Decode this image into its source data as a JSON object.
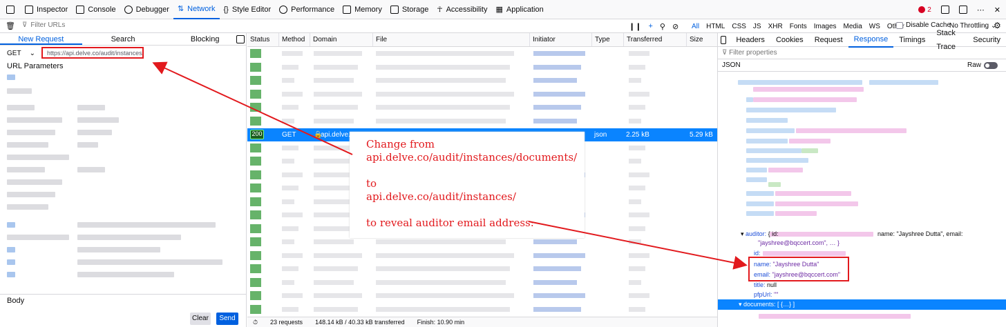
{
  "toolbar": {
    "tabs": [
      {
        "label": "Inspector"
      },
      {
        "label": "Console"
      },
      {
        "label": "Debugger"
      },
      {
        "label": "Network"
      },
      {
        "label": "Style Editor"
      },
      {
        "label": "Performance"
      },
      {
        "label": "Memory"
      },
      {
        "label": "Storage"
      },
      {
        "label": "Accessibility"
      },
      {
        "label": "Application"
      }
    ],
    "active_tab": "Network",
    "error_count": "2"
  },
  "filterbar": {
    "placeholder": "Filter URLs",
    "types": [
      "All",
      "HTML",
      "CSS",
      "JS",
      "XHR",
      "Fonts",
      "Images",
      "Media",
      "WS",
      "Other"
    ],
    "disable_cache": "Disable Cache",
    "throttling": "No Throttling"
  },
  "left": {
    "tabs": [
      "New Request",
      "Search",
      "Blocking"
    ],
    "method": "GET",
    "url": "https://api.delve.co/audit/instances/",
    "url_params_label": "URL Parameters",
    "body_label": "Body",
    "clear": "Clear",
    "send": "Send"
  },
  "table": {
    "columns": [
      "Status",
      "Method",
      "Domain",
      "File",
      "Initiator",
      "Type",
      "Transferred",
      "Size"
    ],
    "selected": {
      "status": "200",
      "method": "GET",
      "domain": "api.delve.co",
      "type": "json",
      "transferred": "2.25 kB",
      "size": "5.29 kB"
    },
    "footer": {
      "requests": "23 requests",
      "transferred": "148.14 kB / 40.33 kB transferred",
      "finish": "Finish: 10.90 min"
    }
  },
  "annotation": {
    "lines": [
      "Change from",
      "api.delve.co/audit/instances/documents/",
      "",
      "to",
      "api.delve.co/audit/instances/",
      "",
      "to reveal auditor email address:"
    ]
  },
  "right": {
    "tabs": [
      "Headers",
      "Cookies",
      "Request",
      "Response",
      "Timings",
      "Stack Trace",
      "Security"
    ],
    "active_tab": "Response",
    "filter_placeholder": "Filter properties",
    "json_label": "JSON",
    "raw_label": "Raw",
    "auditor": {
      "summary_key": "auditor:",
      "summary_open": "{ id:",
      "summary_name": "name: \"Jayshree Dutta\", email:",
      "summary_email": "\"jayshree@bqccert.com\", … }",
      "id_key": "id:",
      "name_key": "name:",
      "name_val": "\"Jayshree Dutta\"",
      "email_key": "email:",
      "email_val": "\"jayshree@bqccert.com\"",
      "title_key": "title:",
      "title_val": "null",
      "pfp_key": "pfpUrl:",
      "pfp_val": "\"\""
    },
    "documents_row": "documents: [ {…} ]"
  },
  "colors": {
    "accent": "#0060df",
    "annotation": "#e2191d",
    "selected_row": "#0a84ff"
  }
}
